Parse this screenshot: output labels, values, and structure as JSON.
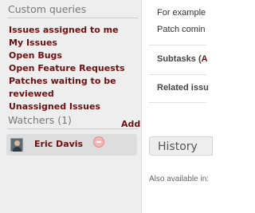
{
  "sidebar": {
    "custom_queries_title": "Custom queries",
    "queries": [
      "Issues assigned to me",
      "My Issues",
      "Open Bugs",
      "Open Feature Requests",
      "Patches waiting to be",
      "reviewed",
      "Unassigned Issues"
    ],
    "watchers_title": "Watchers (1)",
    "add_label": "Add",
    "watchers": [
      {
        "name": "Eric Davis",
        "remove_icon": "remove-circle-icon"
      }
    ]
  },
  "main": {
    "text_line_1": "For example",
    "text_line_2": "Patch comin",
    "subtasks_label": "Subtasks (",
    "subtasks_link": "A",
    "related_label": "Related issu",
    "history_title": "History",
    "also_available": "Also available in:"
  },
  "colors": {
    "link": "#6f1010",
    "sidebar_bg": "#eeeeee"
  }
}
